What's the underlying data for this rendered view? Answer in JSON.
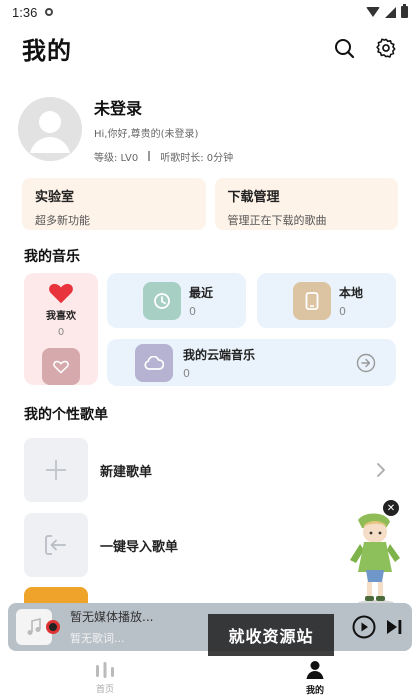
{
  "status_bar": {
    "time": "1:36"
  },
  "header": {
    "title": "我的",
    "search_icon": "search-icon",
    "settings_icon": "gear-icon"
  },
  "profile": {
    "username": "未登录",
    "greeting": "Hi,你好,尊贵的(未登录)",
    "level": "等级: LV0",
    "listen_time": "听歌时长: 0分钟"
  },
  "features": [
    {
      "title": "实验室",
      "subtitle": "超多新功能"
    },
    {
      "title": "下载管理",
      "subtitle": "管理正在下载的歌曲"
    }
  ],
  "my_music": {
    "section_title": "我的音乐",
    "favorites": {
      "label": "我喜欢",
      "count": "0"
    },
    "recent": {
      "label": "最近",
      "count": "0"
    },
    "local": {
      "label": "本地",
      "count": "0"
    },
    "cloud": {
      "label": "我的云端音乐",
      "count": "0"
    }
  },
  "playlists": {
    "section_title": "我的个性歌单",
    "items": [
      {
        "label": "新建歌单"
      },
      {
        "label": "一键导入歌单"
      }
    ]
  },
  "player": {
    "title": "暂无媒体播放...",
    "lyric": "暂无歌词..."
  },
  "watermark": "就收资源站",
  "tabs": [
    {
      "label": "首页"
    },
    {
      "label": "我的"
    }
  ],
  "colors": {
    "feature_bg": "#fdf3e8",
    "favorites_bg": "#fde9ea",
    "music_card_bg": "#eaf3fb",
    "heart_red": "#e8333c",
    "player_bg": "#b8c0c8"
  }
}
